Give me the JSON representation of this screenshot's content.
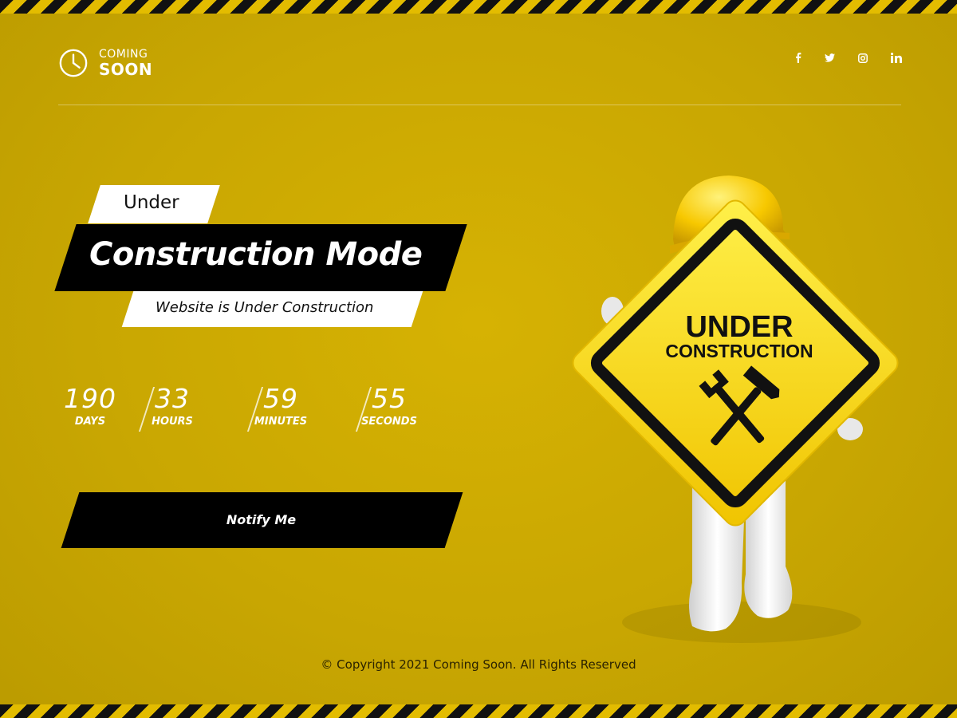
{
  "logo": {
    "line1": "COMING",
    "line2": "SOON"
  },
  "social": {
    "facebook": "f",
    "twitter": "t",
    "instagram": "ig",
    "linkedin": "in"
  },
  "headline": {
    "tag": "Under",
    "title": "Construction Mode",
    "subtitle": "Website is Under Construction"
  },
  "countdown": {
    "days": {
      "value": "190",
      "label": "DAYS"
    },
    "hours": {
      "value": "33",
      "label": "HOURS"
    },
    "minutes": {
      "value": "59",
      "label": "MINUTES"
    },
    "seconds": {
      "value": "55",
      "label": "SECONDS"
    }
  },
  "notify": {
    "label": "Notify Me"
  },
  "sign": {
    "line1": "UNDER",
    "line2": "CONSTRUCTION"
  },
  "footer": {
    "copyright": "© Copyright 2021 Coming Soon. All Rights Reserved"
  },
  "colors": {
    "background": "#c9a702",
    "stripe_dark": "#111111",
    "accent_black": "#000000",
    "sign_yellow": "#ffd400"
  }
}
